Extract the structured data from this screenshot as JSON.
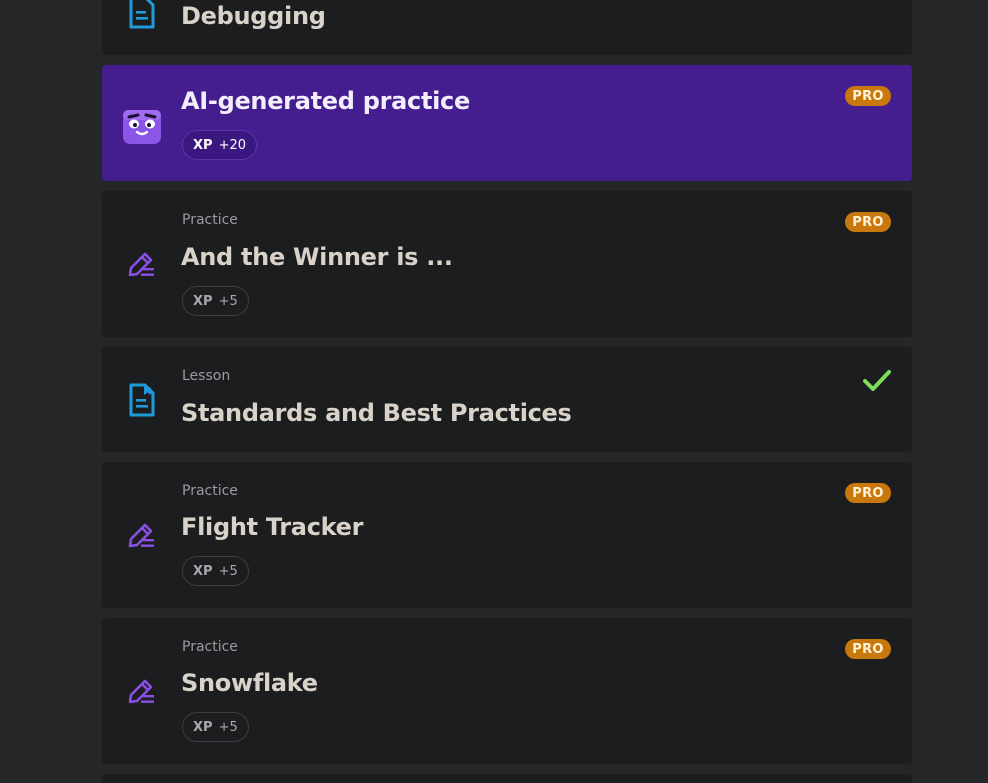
{
  "items": [
    {
      "type": "",
      "title": "Debugging",
      "icon": "lesson-doc-icon"
    },
    {
      "type": "",
      "title": "AI-generated practice",
      "xp_label": "XP",
      "xp_value": "+20",
      "badge": "PRO",
      "icon": "ai-mascot-icon",
      "accent": "#441d8f"
    },
    {
      "type": "Practice",
      "title": "And the Winner is ...",
      "xp_label": "XP",
      "xp_value": "+5",
      "badge": "PRO",
      "icon": "pencil-lines-icon"
    },
    {
      "type": "Lesson",
      "title": "Standards and Best Practices",
      "status": "completed",
      "icon": "lesson-doc-icon"
    },
    {
      "type": "Practice",
      "title": "Flight Tracker",
      "xp_label": "XP",
      "xp_value": "+5",
      "badge": "PRO",
      "icon": "pencil-lines-icon"
    },
    {
      "type": "Practice",
      "title": "Snowflake",
      "xp_label": "XP",
      "xp_value": "+5",
      "badge": "PRO",
      "icon": "pencil-lines-icon"
    }
  ],
  "colors": {
    "background": "#252628",
    "card": "#1c1d1f",
    "ai_card": "#441d8f",
    "pro_badge": "#c8780c",
    "check": "#7ddc5a",
    "practice_icon": "#8a4fe6",
    "lesson_icon": "#1f9bdb"
  }
}
